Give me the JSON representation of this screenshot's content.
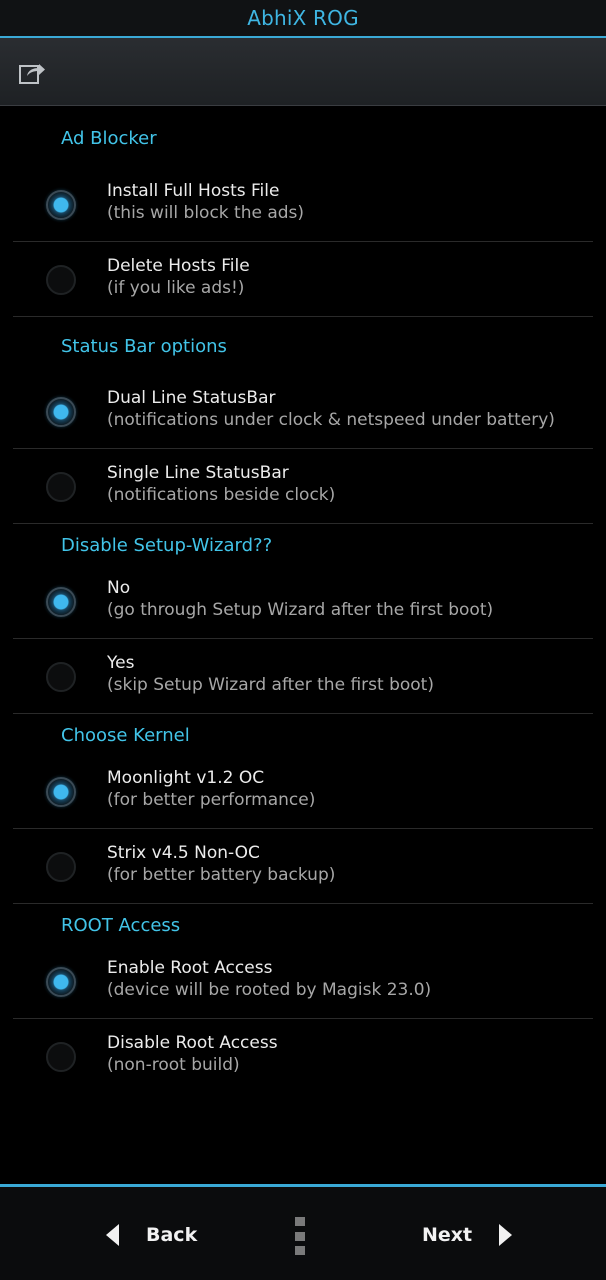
{
  "header": {
    "title": "AbhiX ROG"
  },
  "toolbar": {
    "share_icon": "share-icon"
  },
  "sections": [
    {
      "title": "Ad Blocker",
      "options": [
        {
          "title": "Install Full Hosts File",
          "subtitle": "(this will block the ads)",
          "checked": true
        },
        {
          "title": "Delete Hosts File",
          "subtitle": "(if you like ads!)",
          "checked": false
        }
      ]
    },
    {
      "title": "Status Bar options",
      "options": [
        {
          "title": "Dual Line StatusBar",
          "subtitle": "(notifications under clock & netspeed under battery)",
          "checked": true
        },
        {
          "title": "Single Line StatusBar",
          "subtitle": "(notifications beside clock)",
          "checked": false
        }
      ]
    },
    {
      "title": "Disable Setup-Wizard??",
      "options": [
        {
          "title": "No",
          "subtitle": "(go through Setup Wizard after the first boot)",
          "checked": true
        },
        {
          "title": "Yes",
          "subtitle": "(skip Setup Wizard after the first boot)",
          "checked": false
        }
      ]
    },
    {
      "title": "Choose Kernel",
      "options": [
        {
          "title": "Moonlight v1.2 OC",
          "subtitle": "(for better performance)",
          "checked": true
        },
        {
          "title": "Strix v4.5 Non-OC",
          "subtitle": "(for better battery backup)",
          "checked": false
        }
      ]
    },
    {
      "title": "ROOT Access",
      "options": [
        {
          "title": "Enable Root Access",
          "subtitle": "(device will be rooted by Magisk 23.0)",
          "checked": true
        },
        {
          "title": "Disable Root Access",
          "subtitle": "(non-root build)",
          "checked": false
        }
      ]
    }
  ],
  "footer": {
    "back_label": "Back",
    "next_label": "Next"
  },
  "colors": {
    "accent": "#3aa9d6",
    "section_header": "#42c4e8",
    "background": "#000000"
  }
}
